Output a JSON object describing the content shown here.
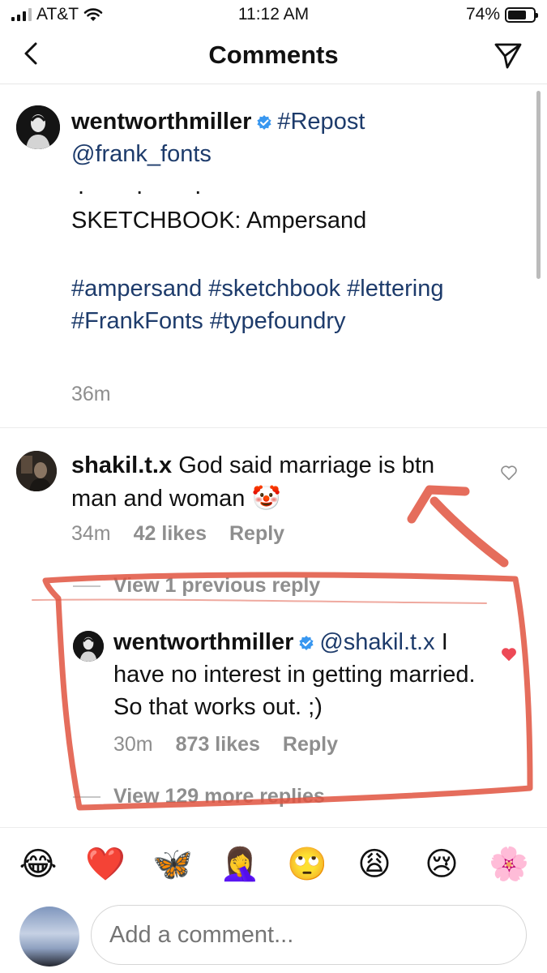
{
  "status_bar": {
    "carrier": "AT&T",
    "time": "11:12 AM",
    "battery_percent": "74%",
    "battery_level": 0.74
  },
  "header": {
    "title": "Comments",
    "back_icon": "chevron-left-icon",
    "send_icon": "paper-plane-icon"
  },
  "caption": {
    "username": "wentworthmiller",
    "verified": true,
    "hashtag_repost": "#Repost",
    "mention": "@frank_fonts",
    "dots": ". . .",
    "text": "SKETCHBOOK: Ampersand",
    "hashtags_line1": "#ampersand #sketchbook #lettering",
    "hashtags_line2": "#FrankFonts #typefoundry",
    "time": "36m"
  },
  "comments": [
    {
      "username": "shakil.t.x",
      "text": "God said marriage is btn man and woman",
      "emoji": "🤡",
      "time": "34m",
      "likes": "42 likes",
      "reply": "Reply",
      "liked": false
    }
  ],
  "view_previous": "View 1 previous reply",
  "reply": {
    "username": "wentworthmiller",
    "verified": true,
    "mention": "@shakil.t.x",
    "text": "I have no interest in getting married. So that works out. ;)",
    "time": "30m",
    "likes": "873 likes",
    "reply": "Reply",
    "liked": true
  },
  "view_more": "View 129 more replies",
  "quick_emojis": [
    "😂",
    "❤️",
    "🦋",
    "🤦‍♀️",
    "🙄",
    "😩",
    "😢",
    "🌸"
  ],
  "composer": {
    "placeholder": "Add a comment..."
  },
  "colors": {
    "link": "#1d3b6b",
    "muted": "#8e8e8e",
    "heart_liked": "#ed4956",
    "annotation": "#e0533f"
  }
}
